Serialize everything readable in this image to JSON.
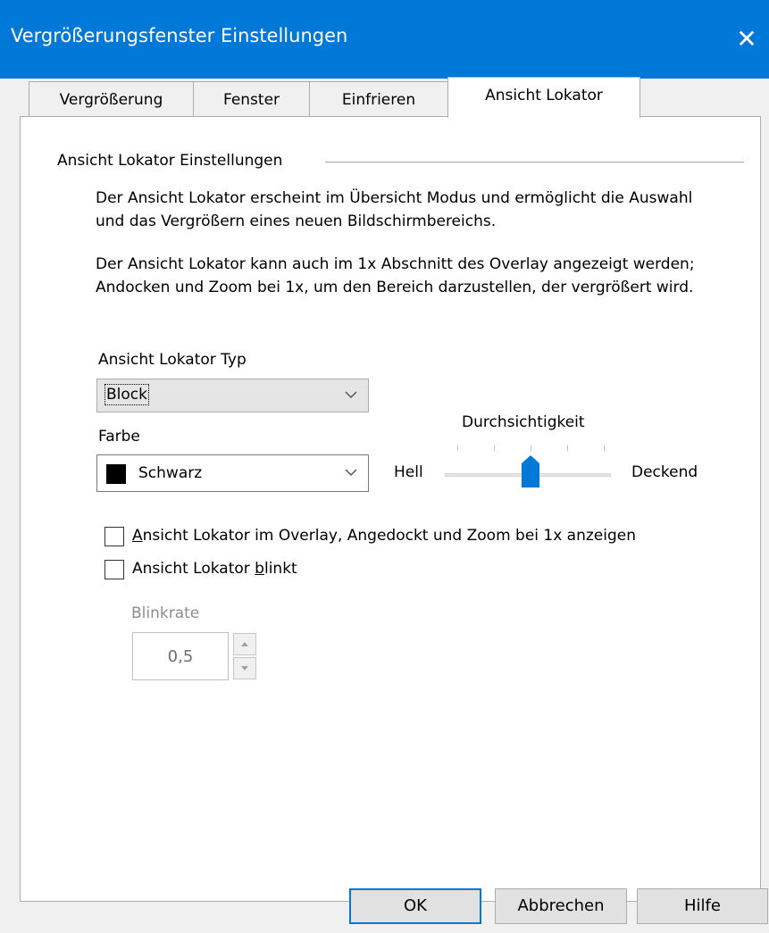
{
  "window": {
    "title": "Vergrößerungsfenster Einstellungen",
    "close_glyph": "✕"
  },
  "tabs": [
    {
      "label": "Vergrößerung"
    },
    {
      "label": "Fenster"
    },
    {
      "label": "Einfrieren"
    },
    {
      "label": "Ansicht Lokator",
      "active": true
    }
  ],
  "group": {
    "title": "Ansicht Lokator Einstellungen",
    "paragraph1": "Der Ansicht Lokator erscheint im Übersicht Modus und ermöglicht die Auswahl und das Vergrößern eines neuen Bildschirmbereichs.",
    "paragraph2": "Der Ansicht Lokator kann auch im 1x Abschnitt des Overlay angezeigt werden; Andocken und Zoom bei 1x, um den Bereich darzustellen, der vergrößert wird."
  },
  "type_combo": {
    "label": "Ansicht Lokator Typ",
    "value": "Block"
  },
  "color_combo": {
    "label": "Farbe",
    "value": "Schwarz",
    "swatch_color": "#000000"
  },
  "transparency": {
    "label": "Durchsichtigkeit",
    "min_label": "Hell",
    "max_label": "Deckend",
    "level": 0.5,
    "thumb_color": "#0078d7"
  },
  "checkbox_overlay": {
    "prefix": "A",
    "rest": "nsicht Lokator im Overlay, Angedockt und Zoom bei 1x anzeigen",
    "checked": false
  },
  "checkbox_blink": {
    "before": "Ansicht Lokator ",
    "mnemonic": "b",
    "after": "linkt",
    "checked": false
  },
  "blink_rate": {
    "label": "Blinkrate",
    "value": "0,5"
  },
  "buttons": {
    "ok": "OK",
    "cancel": "Abbrechen",
    "help": "Hilfe"
  },
  "colors": {
    "titlebar": "#0078d7",
    "accent": "#0078d7"
  }
}
